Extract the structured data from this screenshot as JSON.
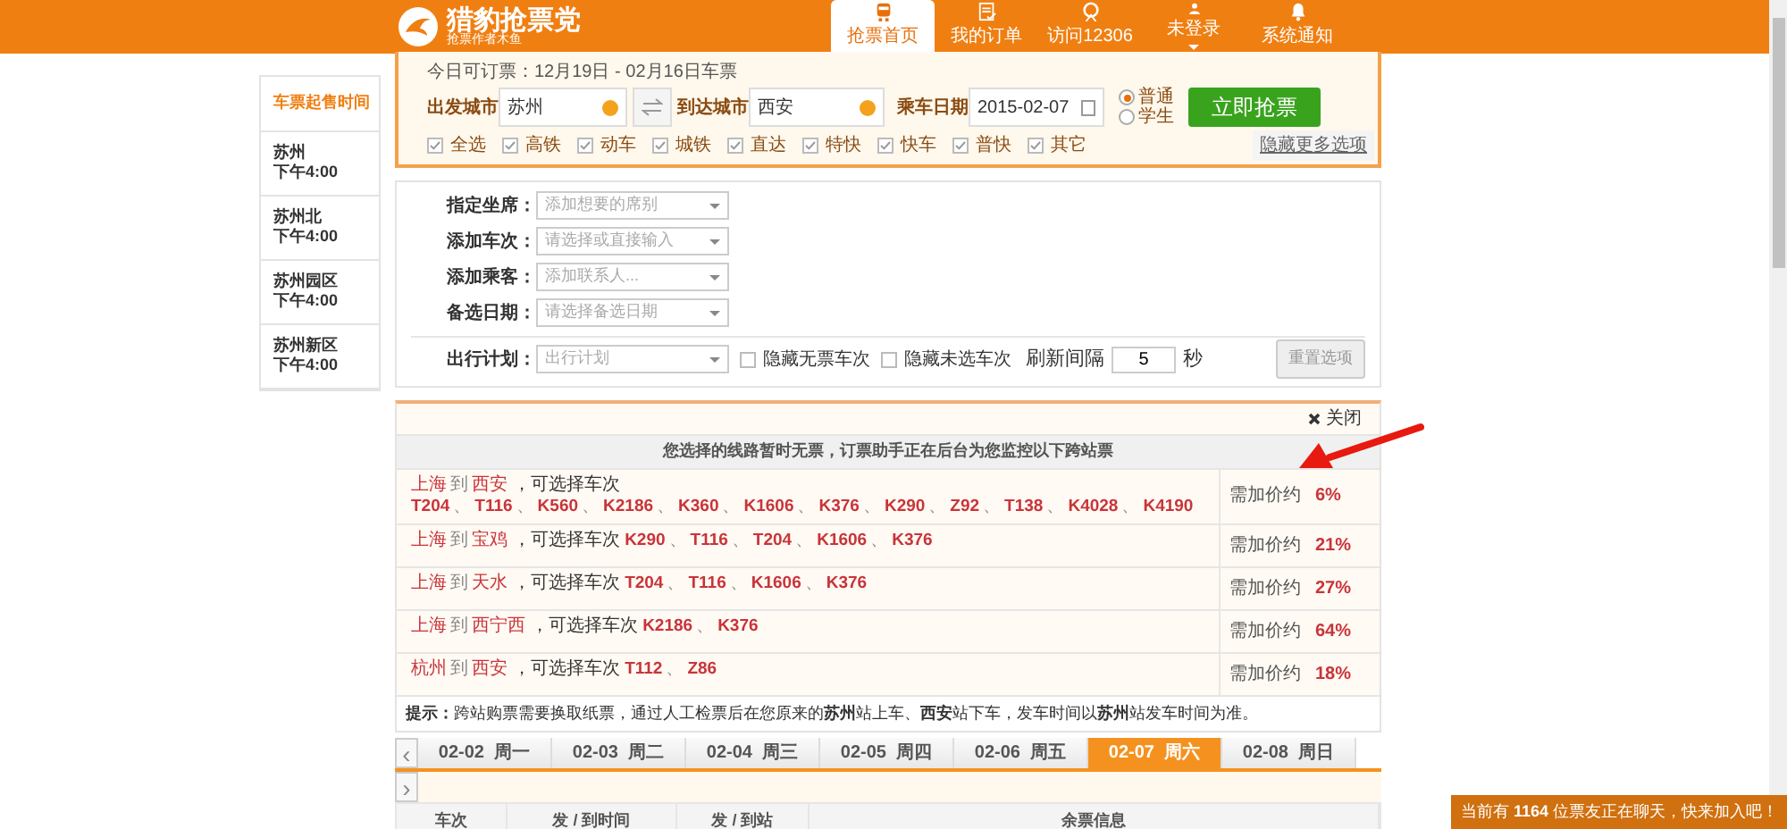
{
  "header": {
    "logo_title": "猎豹抢票党",
    "logo_subtitle": "抢票作者木鱼",
    "nav": [
      {
        "label": "抢票首页",
        "selected": true
      },
      {
        "label": "我的订单",
        "selected": false
      },
      {
        "label": "访问12306",
        "selected": false
      },
      {
        "label": "未登录",
        "selected": false,
        "caret": true
      },
      {
        "label": "系统通知",
        "selected": false
      }
    ]
  },
  "sidebar": {
    "title": "车票起售时间",
    "items": [
      {
        "station": "苏州",
        "time": "下午4:00"
      },
      {
        "station": "苏州北",
        "time": "下午4:00"
      },
      {
        "station": "苏州园区",
        "time": "下午4:00"
      },
      {
        "station": "苏州新区",
        "time": "下午4:00"
      }
    ]
  },
  "search": {
    "bookable": "今日可订票：12月19日 - 02月16日车票",
    "from_label": "出发城市",
    "from": "苏州",
    "to_label": "到达城市",
    "to": "西安",
    "date_label": "乘车日期",
    "date": "2015-02-07",
    "ticket_types": [
      {
        "label": "普通",
        "selected": true
      },
      {
        "label": "学生",
        "selected": false
      }
    ],
    "submit": "立即抢票",
    "train_types": [
      {
        "label": "全选",
        "checked": true
      },
      {
        "label": "高铁",
        "checked": true
      },
      {
        "label": "动车",
        "checked": true
      },
      {
        "label": "城铁",
        "checked": true
      },
      {
        "label": "直达",
        "checked": true
      },
      {
        "label": "特快",
        "checked": true
      },
      {
        "label": "快车",
        "checked": true
      },
      {
        "label": "普快",
        "checked": true
      },
      {
        "label": "其它",
        "checked": true
      }
    ],
    "more_link": "隐藏更多选项"
  },
  "options": {
    "fields": [
      {
        "label": "指定坐席：",
        "placeholder": "添加想要的席别"
      },
      {
        "label": "添加车次：",
        "placeholder": "请选择或直接输入"
      },
      {
        "label": "添加乘客：",
        "placeholder": "添加联系人..."
      },
      {
        "label": "备选日期：",
        "placeholder": "请选择备选日期"
      }
    ],
    "plan_label": "出行计划：",
    "plan_placeholder": "出行计划",
    "checks": [
      {
        "label": "隐藏无票车次",
        "checked": false
      },
      {
        "label": "隐藏未选车次",
        "checked": false
      }
    ],
    "refresh_label": "刷新间隔",
    "refresh_value": "5",
    "refresh_unit": "秒",
    "reset": "重置选项"
  },
  "notice": {
    "close": "关闭",
    "separator": "、",
    "heading": "您选择的线路暂时无票，订票助手正在后台为您监控以下跨站票",
    "rows": [
      {
        "from": "上海",
        "to_word": "到",
        "to": "西安",
        "choose": "，可选择车次",
        "trains": [
          "T204",
          "T116",
          "K560",
          "K2186",
          "K360",
          "K1606",
          "K376",
          "K290",
          "Z92",
          "T138",
          "K4028",
          "K4190"
        ],
        "extra": "需加价约",
        "percent": "6%"
      },
      {
        "from": "上海",
        "to_word": "到",
        "to": "宝鸡",
        "choose": "，可选择车次",
        "trains": [
          "K290",
          "T116",
          "T204",
          "K1606",
          "K376"
        ],
        "extra": "需加价约",
        "percent": "21%"
      },
      {
        "from": "上海",
        "to_word": "到",
        "to": "天水",
        "choose": "，可选择车次",
        "trains": [
          "T204",
          "T116",
          "K1606",
          "K376"
        ],
        "extra": "需加价约",
        "percent": "27%"
      },
      {
        "from": "上海",
        "to_word": "到",
        "to": "西宁西",
        "choose": "，可选择车次",
        "trains": [
          "K2186",
          "K376"
        ],
        "extra": "需加价约",
        "percent": "64%"
      },
      {
        "from": "杭州",
        "to_word": "到",
        "to": "西安",
        "choose": "，可选择车次",
        "trains": [
          "T112",
          "Z86"
        ],
        "extra": "需加价约",
        "percent": "18%"
      }
    ],
    "tip_label": "提示：",
    "tip": "跨站购票需要换取纸票，通过人工检票后在您原来的**苏州**站上车、**西安**站下车，发车时间以**苏州**站发车时间为准。"
  },
  "dates": {
    "prev": "‹",
    "next": "›",
    "tabs": [
      {
        "date": "02-02",
        "weekday": "周一",
        "selected": false
      },
      {
        "date": "02-03",
        "weekday": "周二",
        "selected": false
      },
      {
        "date": "02-04",
        "weekday": "周三",
        "selected": false
      },
      {
        "date": "02-05",
        "weekday": "周四",
        "selected": false
      },
      {
        "date": "02-06",
        "weekday": "周五",
        "selected": false
      },
      {
        "date": "02-07",
        "weekday": "周六",
        "selected": true
      },
      {
        "date": "02-08",
        "weekday": "周日",
        "selected": false
      }
    ]
  },
  "table": {
    "columns": [
      "车次",
      "发 / 到时间",
      "发 / 到站",
      "余票信息"
    ]
  },
  "chat_bar": "当前有 **1164** 位票友正在聊天，快来加入吧！"
}
